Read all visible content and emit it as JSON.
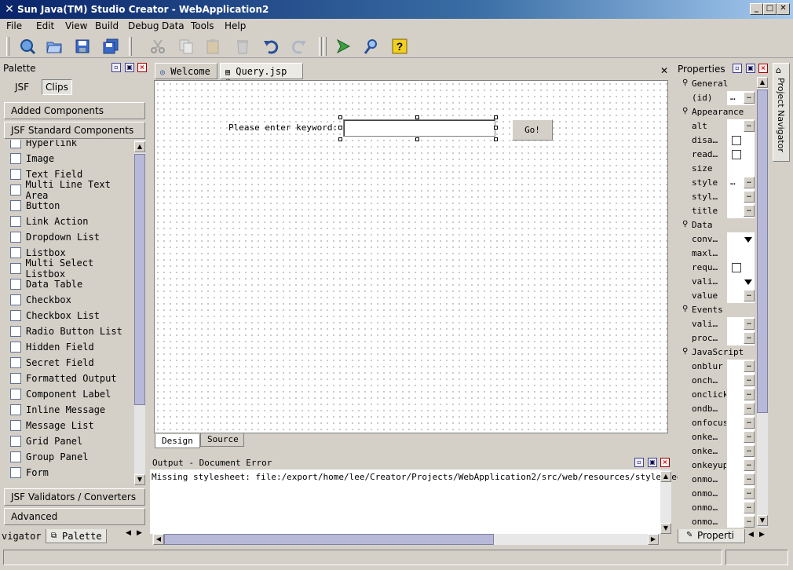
{
  "window": {
    "title": "Sun Java(TM) Studio Creator - WebApplication2"
  },
  "menus": [
    {
      "label": "File"
    },
    {
      "label": "Edit"
    },
    {
      "label": "View"
    },
    {
      "label": "Build"
    },
    {
      "label": "Debug"
    },
    {
      "label": "Data"
    },
    {
      "label": "Tools"
    },
    {
      "label": "Help"
    }
  ],
  "palette": {
    "title": "Palette",
    "tab_jsf": "JSF",
    "tab_clips": "Clips",
    "sections": {
      "added": "Added Components",
      "standard": "JSF Standard Components",
      "validators": "JSF Validators / Converters",
      "advanced": "Advanced"
    },
    "items": [
      {
        "label": "Hyperlink",
        "icon": "hyperlink-icon"
      },
      {
        "label": "Image",
        "icon": "image-icon"
      },
      {
        "label": "Text Field",
        "icon": "text-field-icon"
      },
      {
        "label": "Multi Line Text Area",
        "icon": "text-area-icon"
      },
      {
        "label": "Button",
        "icon": "button-icon"
      },
      {
        "label": "Link Action",
        "icon": "link-action-icon"
      },
      {
        "label": "Dropdown List",
        "icon": "dropdown-icon"
      },
      {
        "label": "Listbox",
        "icon": "listbox-icon"
      },
      {
        "label": "Multi Select Listbox",
        "icon": "multi-listbox-icon"
      },
      {
        "label": "Data Table",
        "icon": "data-table-icon"
      },
      {
        "label": "Checkbox",
        "icon": "checkbox-icon"
      },
      {
        "label": "Checkbox List",
        "icon": "checkbox-list-icon"
      },
      {
        "label": "Radio Button List",
        "icon": "radio-list-icon"
      },
      {
        "label": "Hidden Field",
        "icon": "hidden-field-icon"
      },
      {
        "label": "Secret Field",
        "icon": "secret-field-icon"
      },
      {
        "label": "Formatted Output",
        "icon": "formatted-output-icon"
      },
      {
        "label": "Component Label",
        "icon": "component-label-icon"
      },
      {
        "label": "Inline Message",
        "icon": "inline-message-icon"
      },
      {
        "label": "Message List",
        "icon": "message-list-icon"
      },
      {
        "label": "Grid Panel",
        "icon": "grid-panel-icon"
      },
      {
        "label": "Group Panel",
        "icon": "group-panel-icon"
      },
      {
        "label": "Form",
        "icon": "form-icon"
      }
    ],
    "bottom_tabs": {
      "navigator": "vigator",
      "palette": "Palette"
    }
  },
  "editor": {
    "tabs": [
      {
        "label": "Welcome"
      },
      {
        "label": "Query.jsp *"
      }
    ],
    "design_tab": "Design",
    "source_tab": "Source",
    "form": {
      "keyword_label": "Please enter keyword:",
      "keyword_value": "",
      "go_button": "Go!"
    }
  },
  "output": {
    "title": "Output - Document Error",
    "message": "Missing stylesheet: file:/export/home/lee/Creator/Projects/WebApplication2/src/web/resources/stylesheet.css"
  },
  "properties": {
    "title": "Properties",
    "bottom_tab": "Properti",
    "side_tab": "Project Navigator",
    "categories": [
      {
        "name": "General",
        "rows": [
          {
            "n": "(id)",
            "t": "ellipsis2"
          }
        ]
      },
      {
        "name": "Appearance",
        "rows": [
          {
            "n": "alt",
            "t": "ellipsis"
          },
          {
            "n": "disa…",
            "t": "check"
          },
          {
            "n": "read…",
            "t": "check"
          },
          {
            "n": "size",
            "t": "none"
          },
          {
            "n": "style",
            "t": "ellipsis2"
          },
          {
            "n": "styl…",
            "t": "ellipsis"
          },
          {
            "n": "title",
            "t": "ellipsis"
          }
        ]
      },
      {
        "name": "Data",
        "rows": [
          {
            "n": "conv…",
            "t": "dropdown"
          },
          {
            "n": "maxl…",
            "t": "none"
          },
          {
            "n": "requ…",
            "t": "check"
          },
          {
            "n": "vali…",
            "t": "dropdown"
          },
          {
            "n": "value",
            "t": "ellipsis"
          }
        ]
      },
      {
        "name": "Events",
        "rows": [
          {
            "n": "vali…",
            "t": "ellipsis"
          },
          {
            "n": "proc…",
            "t": "ellipsis"
          }
        ]
      },
      {
        "name": "JavaScript",
        "rows": [
          {
            "n": "onblur",
            "t": "ellipsis"
          },
          {
            "n": "onch…",
            "t": "ellipsis"
          },
          {
            "n": "onclick",
            "t": "ellipsis"
          },
          {
            "n": "ondb…",
            "t": "ellipsis"
          },
          {
            "n": "onfocus",
            "t": "ellipsis"
          },
          {
            "n": "onke…",
            "t": "ellipsis"
          },
          {
            "n": "onke…",
            "t": "ellipsis"
          },
          {
            "n": "onkeyup",
            "t": "ellipsis"
          },
          {
            "n": "onmo…",
            "t": "ellipsis"
          },
          {
            "n": "onmo…",
            "t": "ellipsis"
          },
          {
            "n": "onmo…",
            "t": "ellipsis"
          },
          {
            "n": "onmo…",
            "t": "ellipsis"
          }
        ]
      }
    ]
  }
}
